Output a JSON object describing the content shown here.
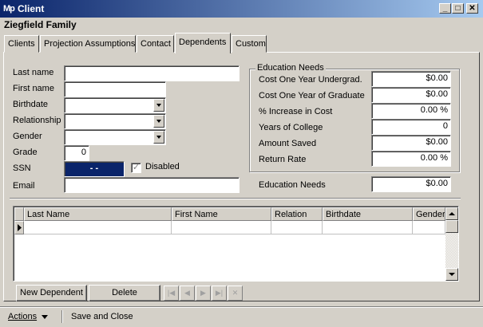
{
  "window": {
    "app_logo": "Mp",
    "title": "Client",
    "minimize_glyph": "_",
    "maximize_glyph": "□",
    "close_glyph": "✕"
  },
  "family_name": "Ziegfield Family",
  "tabs": [
    {
      "label": "Clients"
    },
    {
      "label": "Projection Assumptions"
    },
    {
      "label": "Contact"
    },
    {
      "label": "Dependents",
      "active": true
    },
    {
      "label": "Custom"
    }
  ],
  "form": {
    "last_name_label": "Last name",
    "last_name_value": "",
    "first_name_label": "First name",
    "first_name_value": "",
    "birthdate_label": "Birthdate",
    "birthdate_value": "",
    "relationship_label": "Relationship",
    "relationship_value": "",
    "gender_label": "Gender",
    "gender_value": "",
    "grade_label": "Grade",
    "grade_value": "0",
    "ssn_label": "SSN",
    "ssn_value": "- -",
    "disabled_label": "Disabled",
    "disabled_checked": true,
    "email_label": "Email",
    "email_value": ""
  },
  "education": {
    "group_title": "Education Needs",
    "rows": [
      {
        "label": "Cost One Year Undergrad.",
        "value": "$0.00"
      },
      {
        "label": "Cost One Year of Graduate",
        "value": "$0.00"
      },
      {
        "label": "% Increase in Cost",
        "value": "0.00 %"
      },
      {
        "label": "Years of College",
        "value": "0"
      },
      {
        "label": "Amount Saved",
        "value": "$0.00"
      },
      {
        "label": "Return Rate",
        "value": "0.00 %"
      }
    ],
    "total_label": "Education Needs",
    "total_value": "$0.00"
  },
  "grid": {
    "columns": [
      "Last Name",
      "First Name",
      "Relation",
      "Birthdate",
      "Gender"
    ],
    "rows": [
      [
        "",
        "",
        "",
        "",
        ""
      ]
    ]
  },
  "buttons": {
    "new_dependent": "New Dependent",
    "delete": "Delete",
    "nav_first": "|◀",
    "nav_prev": "◀",
    "nav_next": "▶",
    "nav_last": "▶|",
    "nav_cancel": "✕"
  },
  "footer": {
    "actions_label": "Actions",
    "save_close_label": "Save and Close"
  },
  "colors": {
    "titlebar_start": "#0a246a",
    "titlebar_end": "#a6caf0",
    "face": "#d4d0c8",
    "ssn_highlight": "#0a246a"
  }
}
